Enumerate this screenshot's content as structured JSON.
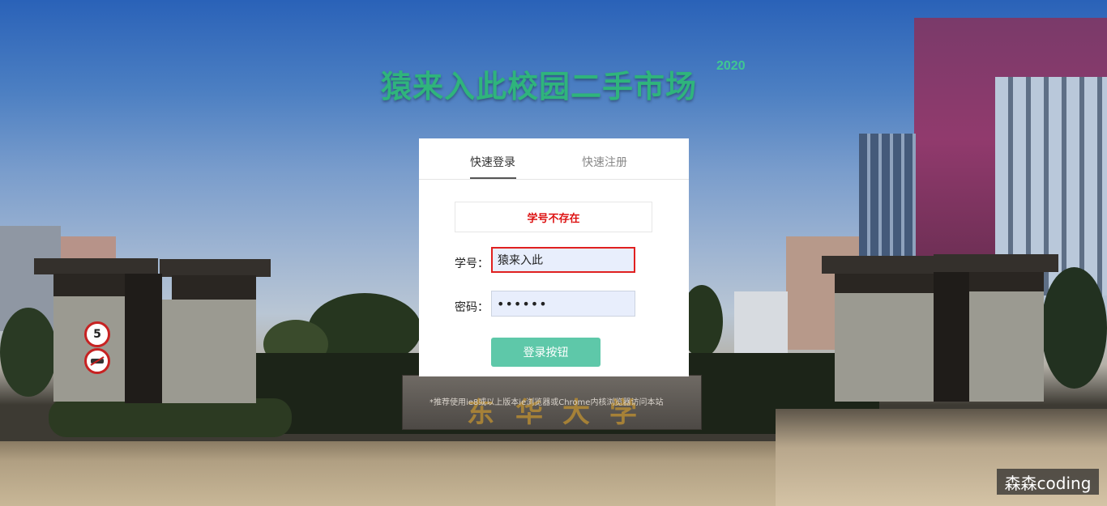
{
  "site": {
    "title": "猿来入此校园二手市场",
    "year": "2020"
  },
  "tabs": [
    {
      "label": "快速登录",
      "active": true
    },
    {
      "label": "快速注册",
      "active": false
    }
  ],
  "login": {
    "error_message": "学号不存在",
    "student_id_label": "学号：",
    "student_id_value": "猿来入此",
    "password_label": "密码：",
    "password_value": "••••••",
    "submit_label": "登录按钮"
  },
  "background": {
    "gate_inscription": [
      "东",
      "华",
      "大",
      "学"
    ],
    "speed_sign": "5"
  },
  "footer": {
    "browser_hint": "*推荐使用ie8或以上版本ie浏览器或Chrome内核浏览器访问本站"
  },
  "watermark": {
    "text": "森森coding"
  },
  "colors": {
    "title_green": "#2fb47c",
    "button_green": "#5ec8a9",
    "error_red": "#dd1111",
    "input_bg": "#e8eefc"
  }
}
